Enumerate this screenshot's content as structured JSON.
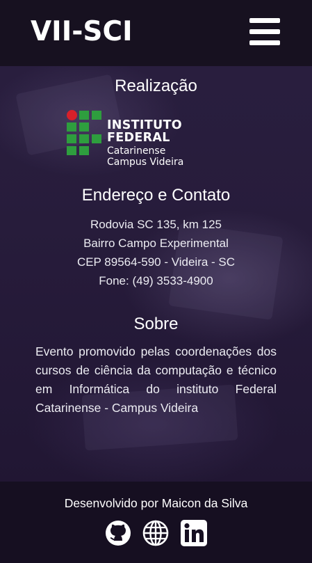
{
  "header": {
    "brand": "VII-SCI",
    "menu_icon": "hamburger-menu-icon"
  },
  "organizer": {
    "title": "Realização",
    "logo": {
      "name": "INSTITUTO FEDERAL",
      "line1": "Catarinense",
      "line2": "Campus Videira",
      "green": "#2e9e3e",
      "red": "#d8202a"
    }
  },
  "contact": {
    "title": "Endereço e Contato",
    "lines": [
      "Rodovia SC 135, km 125",
      "Bairro Campo Experimental",
      "CEP 89564-590 - Videira - SC",
      "Fone: (49) 3533-4900"
    ]
  },
  "about": {
    "title": "Sobre",
    "text": "Evento promovido pelas coordenações dos cursos de ciência da computação e técnico em Informática do instituto Federal Catarinense - Campus Videira"
  },
  "footer": {
    "credit": "Desenvolvido por Maicon da Silva",
    "social": [
      "github-icon",
      "globe-icon",
      "linkedin-icon"
    ]
  }
}
